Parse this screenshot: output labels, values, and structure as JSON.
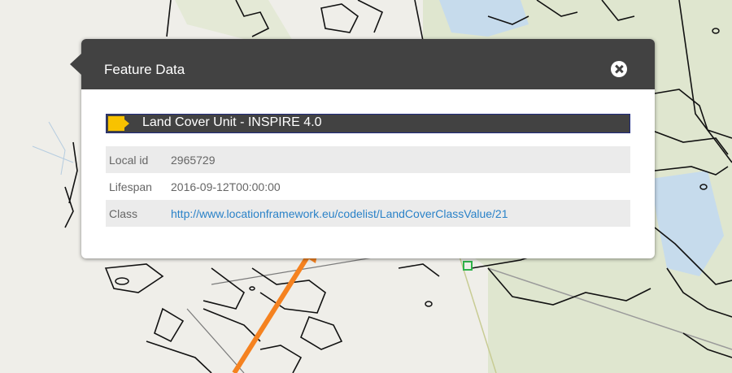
{
  "popup": {
    "title": "Feature Data",
    "close_icon": "close-circle-icon",
    "layer": {
      "title": "Land Cover Unit - INSPIRE 4.0",
      "swatch_color": "#f8c200"
    },
    "attributes": [
      {
        "key": "Local id",
        "value": "2965729"
      },
      {
        "key": "Lifespan",
        "value": "2016-09-12T00:00:00"
      },
      {
        "key": "Class",
        "value": "http://www.locationframework.eu/codelist/LandCoverClassValue/21"
      }
    ]
  },
  "colors": {
    "header": "#424242",
    "link": "#2a82c8",
    "annotation_arrow": "#f58220",
    "water": "#c6dbec",
    "vegetation": "#dfe6cf"
  }
}
